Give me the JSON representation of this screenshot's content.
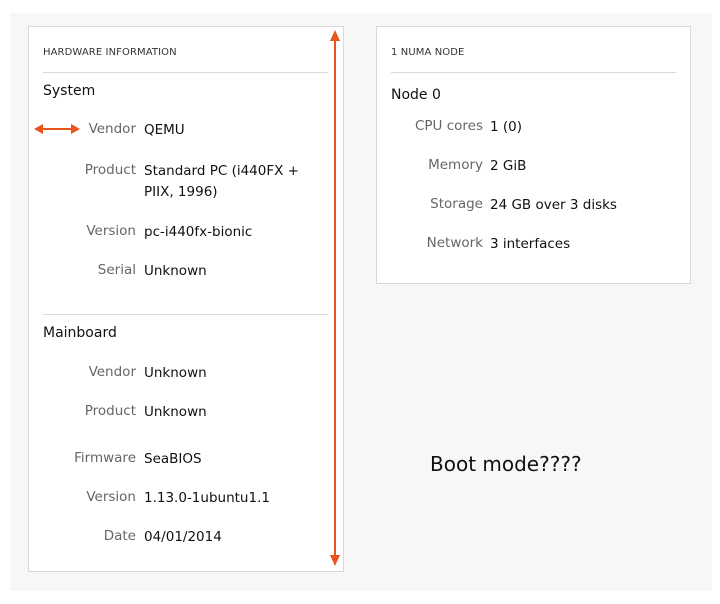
{
  "hardware": {
    "title": "HARDWARE INFORMATION",
    "system": {
      "heading": "System",
      "vendor": {
        "label": "Vendor",
        "value": "QEMU"
      },
      "product": {
        "label": "Product",
        "value_line1": "Standard PC (i440FX +",
        "value_line2": "PIIX, 1996)"
      },
      "version": {
        "label": "Version",
        "value": "pc-i440fx-bionic"
      },
      "serial": {
        "label": "Serial",
        "value": "Unknown"
      }
    },
    "mainboard": {
      "heading": "Mainboard",
      "vendor": {
        "label": "Vendor",
        "value": "Unknown"
      },
      "product": {
        "label": "Product",
        "value": "Unknown"
      },
      "firmware": {
        "label": "Firmware",
        "value": "SeaBIOS"
      },
      "version": {
        "label": "Version",
        "value": "1.13.0-1ubuntu1.1"
      },
      "date": {
        "label": "Date",
        "value": "04/01/2014"
      }
    }
  },
  "numa": {
    "title": "1 NUMA NODE",
    "node": "Node 0",
    "cpu": {
      "label": "CPU cores",
      "value": "1 (0)"
    },
    "memory": {
      "label": "Memory",
      "value": "2 GiB"
    },
    "storage": {
      "label": "Storage",
      "value": "24 GB over 3 disks"
    },
    "network": {
      "label": "Network",
      "value": "3 interfaces"
    }
  },
  "annotation": {
    "text": "Boot mode????",
    "color": "#e8541c"
  },
  "colors": {
    "background": "#f7f7f7",
    "card": "#ffffff",
    "border": "#d9d9d9",
    "label": "#666666"
  }
}
